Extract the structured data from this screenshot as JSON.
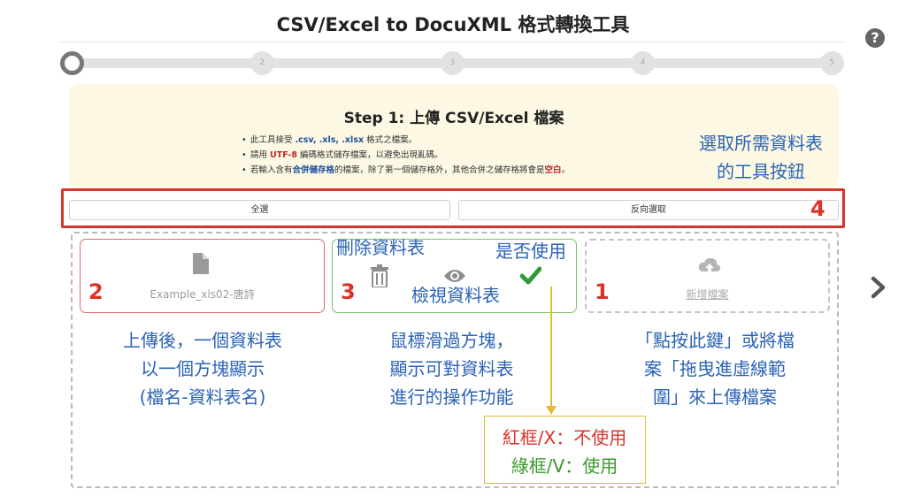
{
  "header": {
    "title": "CSV/Excel to DocuXML 格式轉換工具"
  },
  "stepper": {
    "steps": [
      "",
      "2",
      "3",
      "4",
      "5"
    ]
  },
  "instructions": {
    "title": "Step 1: 上傳 CSV/Excel 檔案",
    "item1": {
      "pre": "此工具接受 ",
      "formats": ".csv, .xls, .xlsx",
      "post": " 格式之檔案。"
    },
    "item2": {
      "pre": "請用 ",
      "encoding": "UTF-8",
      "post": " 編碼格式儲存檔案，以避免出現亂碼。"
    },
    "item3": {
      "pre": "若輸入含有",
      "merged": "合併儲存格",
      "mid": "的檔案，除了第一個儲存格外，其他合併之儲存格將會是",
      "blank": "空白",
      "post": "。"
    }
  },
  "toolbar": {
    "select_all_label": "全選",
    "invert_label": "反向選取"
  },
  "cards": {
    "sheet_name": "Example_xls02-唐詩",
    "add_file_label": "新增檔案"
  },
  "annotations": {
    "toolbar_note_line1": "選取所需資料表",
    "toolbar_note_line2": "的工具按鈕",
    "num1": "1",
    "num2": "2",
    "num3": "3",
    "num4": "4",
    "delete_label": "刪除資料表",
    "use_label": "是否使用",
    "view_label": "檢視資料表",
    "sheet_note_line1": "上傳後，一個資料表",
    "sheet_note_line2": "以一個方塊顯示",
    "sheet_note_line3": "(檔名-資料表名)",
    "hover_note_line1": "鼠標滑過方塊，",
    "hover_note_line2": "顯示可對資料表",
    "hover_note_line3": "進行的操作功能",
    "upload_note_line1": "「點按此鍵」或將檔",
    "upload_note_line2": "案「拖曳進虛線範",
    "upload_note_line3": "圍」來上傳檔案",
    "legend_red": "紅框/X：不使用",
    "legend_green": "綠框/V：使用"
  },
  "colors": {
    "annotation_blue": "#2b63b5",
    "annotation_red": "#d9342b",
    "legend_green": "#3a9a2c",
    "info_bg": "#fcf8e3",
    "connector_yellow": "#e6b93a"
  },
  "icons": [
    "help-icon",
    "file-icon",
    "trash-icon",
    "eye-icon",
    "check-icon",
    "cloud-upload-icon",
    "chevron-right-icon"
  ]
}
